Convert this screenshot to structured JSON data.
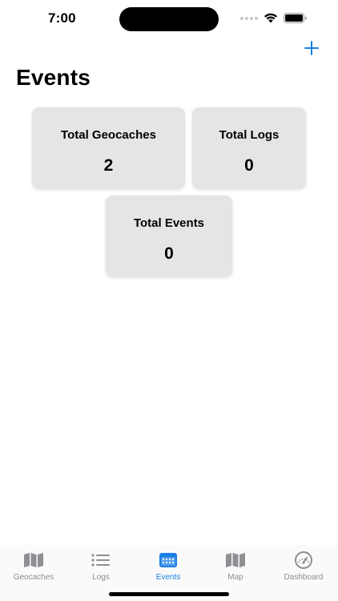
{
  "status_bar": {
    "time": "7:00"
  },
  "nav": {
    "title": "Events",
    "add_icon": "plus-icon"
  },
  "stats": [
    {
      "label": "Total Geocaches",
      "value": "2"
    },
    {
      "label": "Total Logs",
      "value": "0"
    },
    {
      "label": "Total Events",
      "value": "0"
    }
  ],
  "tabs": [
    {
      "label": "Geocaches",
      "icon": "map-icon"
    },
    {
      "label": "Logs",
      "icon": "list-icon"
    },
    {
      "label": "Events",
      "icon": "calendar-icon"
    },
    {
      "label": "Map",
      "icon": "map-icon"
    },
    {
      "label": "Dashboard",
      "icon": "gauge-icon"
    }
  ],
  "active_tab": "Events",
  "colors": {
    "accent": "#1a7fe6",
    "card_bg": "#e5e5e7",
    "tab_inactive": "#8e8e93"
  }
}
